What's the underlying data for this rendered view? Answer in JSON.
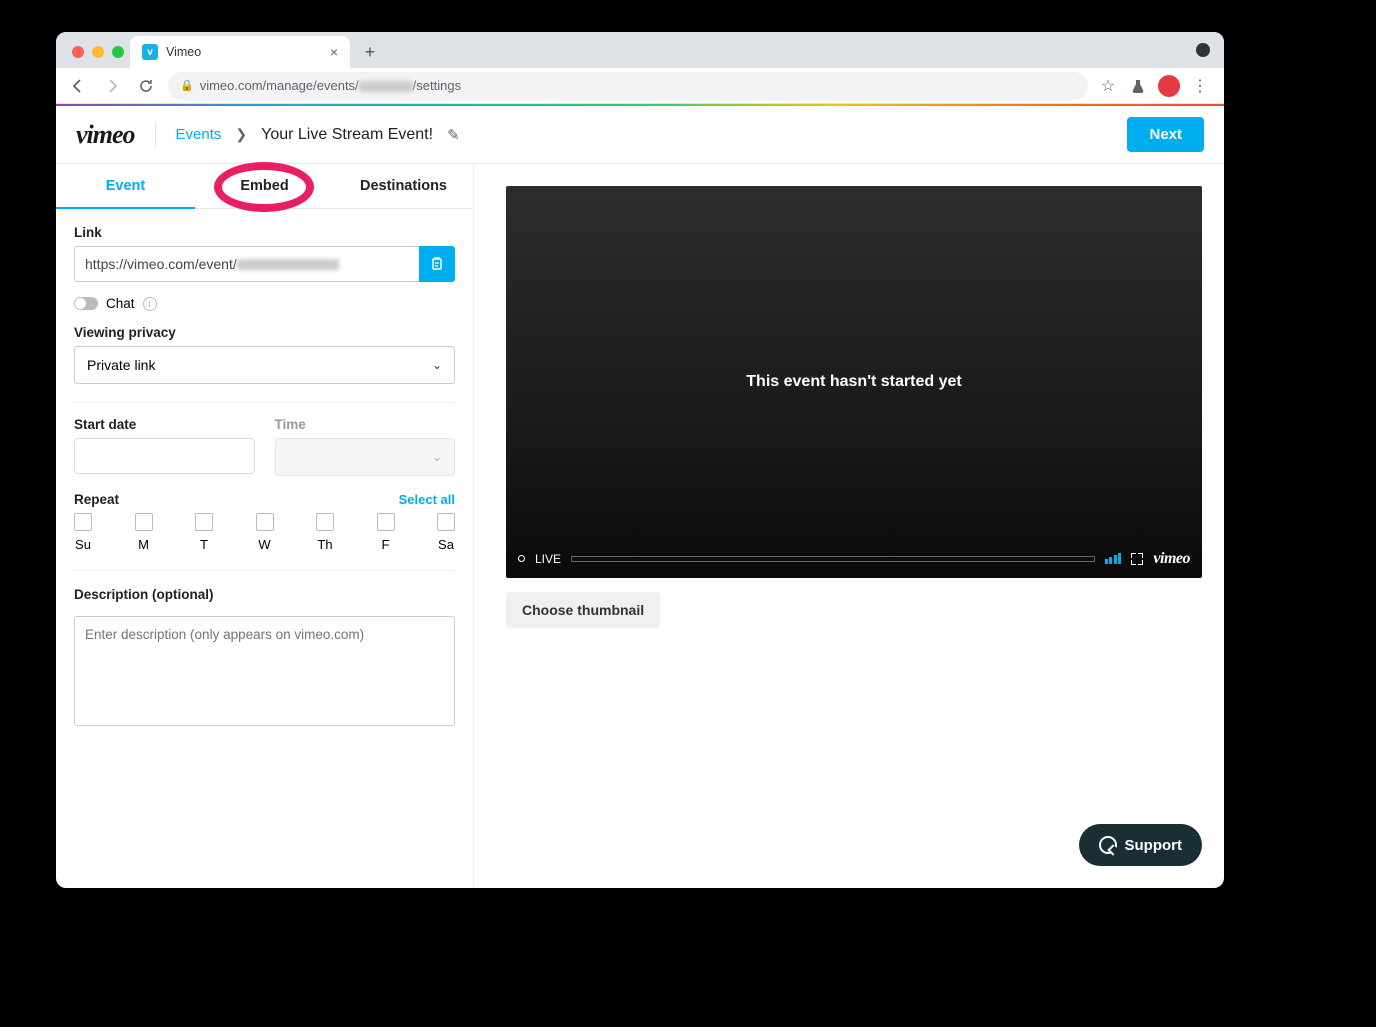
{
  "browser": {
    "tab_title": "Vimeo",
    "url_prefix": "vimeo.com/manage/events/",
    "url_suffix": "/settings"
  },
  "header": {
    "logo": "vimeo",
    "breadcrumb_root": "Events",
    "breadcrumb_title": "Your Live Stream Event!",
    "next_button": "Next"
  },
  "tabs": {
    "event": "Event",
    "embed": "Embed",
    "destinations": "Destinations"
  },
  "form": {
    "link_label": "Link",
    "link_value_prefix": "https://vimeo.com/event/",
    "chat_label": "Chat",
    "privacy_label": "Viewing privacy",
    "privacy_value": "Private link",
    "start_date_label": "Start date",
    "time_label": "Time",
    "repeat_label": "Repeat",
    "select_all": "Select all",
    "days": [
      "Su",
      "M",
      "T",
      "W",
      "Th",
      "F",
      "Sa"
    ],
    "desc_label": "Description (optional)",
    "desc_placeholder": "Enter description (only appears on vimeo.com)"
  },
  "player": {
    "message": "This event hasn't started yet",
    "live_label": "LIVE",
    "logo": "vimeo"
  },
  "thumbnail_button": "Choose thumbnail",
  "support_label": "Support"
}
